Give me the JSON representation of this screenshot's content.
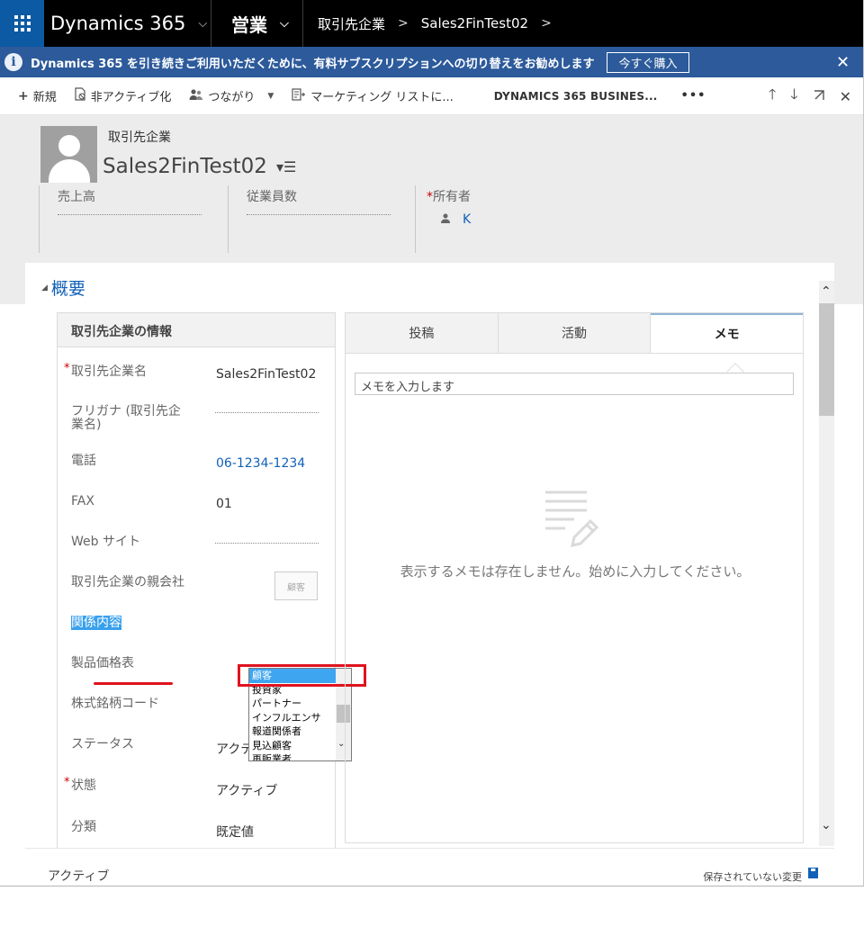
{
  "topnav": {
    "brand": "Dynamics 365",
    "module": "営業",
    "breadcrumb": [
      "取引先企業",
      "Sales2FinTest02"
    ]
  },
  "notice": {
    "info_glyph": "i",
    "message": "Dynamics 365 を引き続きご利用いただくために、有料サブスクリプションへの切り替えをお勧めします",
    "buy_label": "今すぐ購入",
    "close_glyph": "✕"
  },
  "commands": {
    "new": "新規",
    "deactivate": "非アクティブ化",
    "connect": "つながり",
    "marketing": "マーケティング リストに...",
    "business": "DYNAMICS 365 BUSINES...",
    "more": "•••"
  },
  "header": {
    "entity_type": "取引先企業",
    "record_name": "Sales2FinTest02",
    "kpis": {
      "revenue": "売上高",
      "employees": "従業員数",
      "owner_label": "所有者",
      "owner_value": "K",
      "required_mark": "*"
    }
  },
  "section": {
    "title": "概要",
    "info_title": "取引先企業の情報"
  },
  "fields": {
    "account_name_label": "取引先企業名",
    "account_name_value": "Sales2FinTest02",
    "furigana_label": "フリガナ (取引先企業名)",
    "phone_label": "電話",
    "phone_value": "06-1234-1234",
    "fax_label": "FAX",
    "fax_value": "01",
    "website_label": "Web サイト",
    "parent_label": "取引先企業の親会社",
    "parent_button": "顧客",
    "relation_label": "関係内容",
    "pricelist_label": "製品価格表",
    "ticker_label": "株式銘柄コード",
    "status_label": "ステータス",
    "status_value": "アクティブ",
    "state_label": "状態",
    "state_value": "アクティブ",
    "category_label": "分類",
    "category_value": "既定値",
    "required_mark": "*"
  },
  "relation_options": [
    "顧客",
    "投資家",
    "パートナー",
    "インフルエンサ",
    "報道関係者",
    "見込顧客",
    "再販業者"
  ],
  "social": {
    "tabs": [
      "投稿",
      "活動",
      "メモ"
    ],
    "note_placeholder": "メモを入力します",
    "empty_message": "表示するメモは存在しません。始めに入力してください。"
  },
  "footer": {
    "status": "アクティブ",
    "unsaved": "保存されていない変更"
  }
}
